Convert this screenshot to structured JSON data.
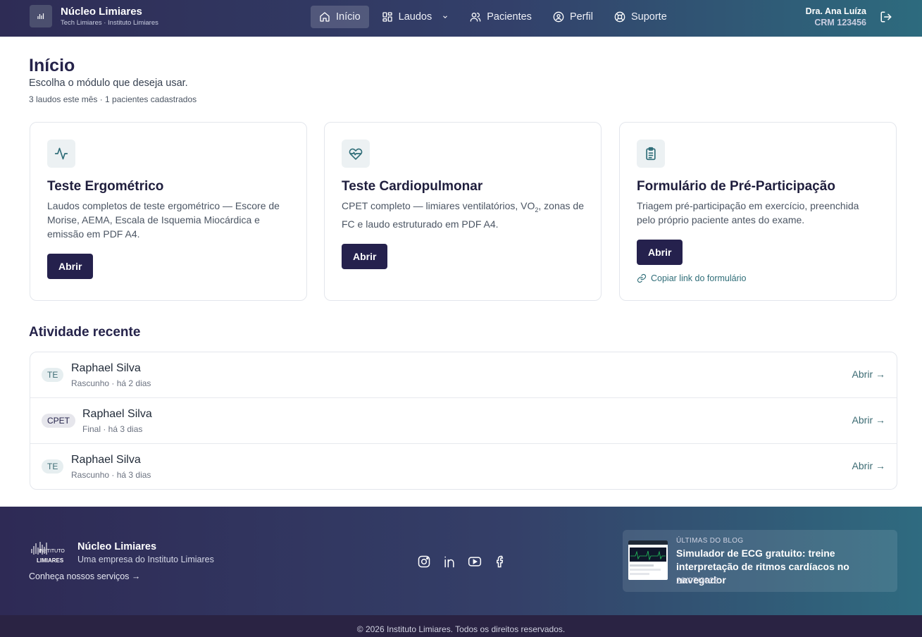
{
  "header": {
    "brand_name": "Núcleo Limiares",
    "brand_sub": "Tech Limiares · Instituto Limiares",
    "nav": {
      "inicio": "Início",
      "laudos": "Laudos",
      "pacientes": "Pacientes",
      "perfil": "Perfil",
      "suporte": "Suporte"
    },
    "user_name": "Dra. Ana Luíza",
    "user_crm": "CRM 123456"
  },
  "page": {
    "title": "Início",
    "subtitle": "Escolha o módulo que deseja usar.",
    "stats": "3 laudos este mês · 1 pacientes cadastrados"
  },
  "modules": [
    {
      "icon": "activity-icon",
      "title": "Teste Ergométrico",
      "description": "Laudos completos de teste ergométrico — Escore de Morise, AEMA, Escala de Isquemia Miocárdica e emissão em PDF A4.",
      "button": "Abrir"
    },
    {
      "icon": "heart-pulse-icon",
      "title": "Teste Cardiopulmonar",
      "description_pre": "CPET completo — limiares ventilatórios, VO",
      "description_sub": "2",
      "description_post": ", zonas de FC e laudo estruturado em PDF A4.",
      "button": "Abrir"
    },
    {
      "icon": "clipboard-icon",
      "title": "Formulário de Pré-Participação",
      "description": "Triagem pré-participação em exercício, preenchida pelo próprio paciente antes do exame.",
      "button": "Abrir",
      "link": "Copiar link do formulário"
    }
  ],
  "recent": {
    "title": "Atividade recente",
    "items": [
      {
        "badge": "TE",
        "name": "Raphael Silva",
        "meta": "Rascunho · há 2 dias",
        "action": "Abrir →"
      },
      {
        "badge": "CPET",
        "name": "Raphael Silva",
        "meta": "Final · há 3 dias",
        "action": "Abrir →"
      },
      {
        "badge": "TE",
        "name": "Raphael Silva",
        "meta": "Rascunho · há 3 dias",
        "action": "Abrir →"
      }
    ]
  },
  "footer": {
    "logo_line1": "INSTITUTO",
    "logo_line2": "LIMIARES",
    "name": "Núcleo Limiares",
    "company": "Uma empresa do Instituto Limiares",
    "services_link": "Conheça nossos serviços →",
    "socials": [
      "instagram-icon",
      "linkedin-icon",
      "youtube-icon",
      "facebook-icon"
    ],
    "blog": {
      "kicker": "ÚLTIMAS DO BLOG",
      "title": "Simulador de ECG gratuito: treine interpretação de ritmos cardíacos no navegador",
      "date": "28/07/2026"
    },
    "copyright": "© 2026 Instituto Limiares. Todos os direitos reservados."
  },
  "colors": {
    "primary_button": "#25214d",
    "accent_teal": "#3c6b73",
    "header_gradient_start": "#2e2c55",
    "header_gradient_end": "#2d6b7e"
  }
}
